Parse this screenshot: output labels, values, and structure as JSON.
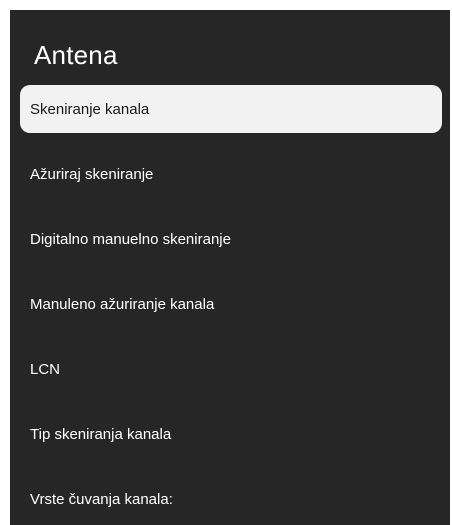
{
  "screen": {
    "title": "Antena",
    "selected_index": 0,
    "menu_items": [
      {
        "label": "Skeniranje kanala"
      },
      {
        "label": "Ažuriraj skeniranje"
      },
      {
        "label": "Digitalno manuelno skeniranje"
      },
      {
        "label": "Manuleno ažuriranje kanala"
      },
      {
        "label": "LCN"
      },
      {
        "label": "Tip skeniranja kanala"
      },
      {
        "label": "Vrste čuvanja kanala:"
      }
    ]
  },
  "colors": {
    "panel_background": "#262626",
    "focused_item_background": "#f2f2f2",
    "text": "#ffffff",
    "focused_text": "#1a1a1a"
  }
}
